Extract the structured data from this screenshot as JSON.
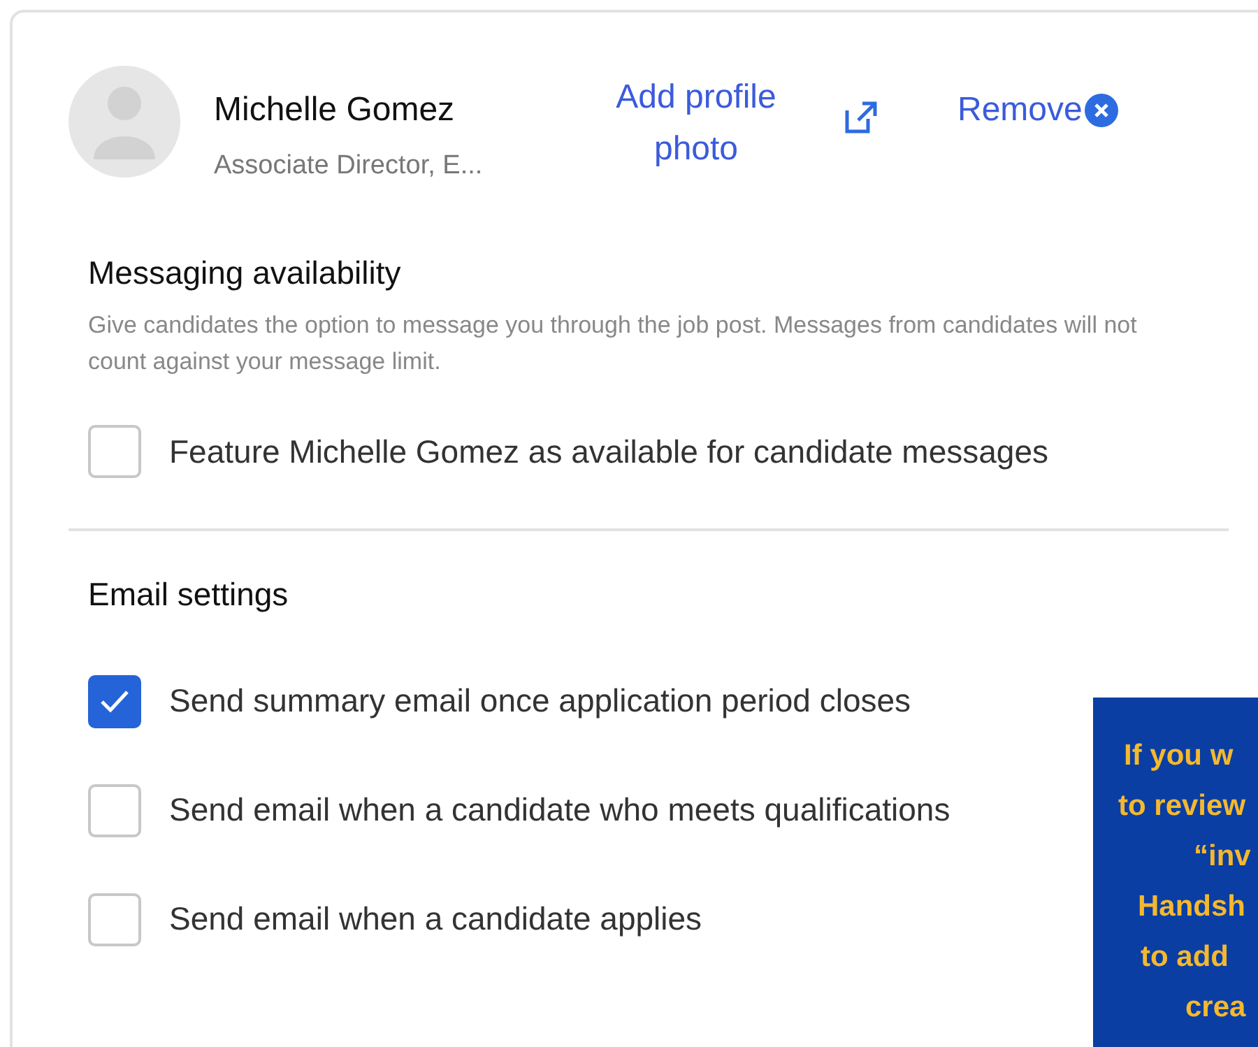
{
  "profile": {
    "name": "Michelle Gomez",
    "title": "Associate Director, E...",
    "add_photo": "Add profile photo",
    "remove": "Remove"
  },
  "messaging": {
    "heading": "Messaging availability",
    "description": "Give candidates the option to message you through the job post. Messages from candidates will not count against your message limit.",
    "options": [
      {
        "label": "Feature Michelle Gomez as available for candidate messages",
        "checked": false
      }
    ]
  },
  "email": {
    "heading": "Email settings",
    "options": [
      {
        "label": "Send summary email once application period closes",
        "checked": true
      },
      {
        "label": "Send email when a candidate who meets qualifications",
        "checked": false
      },
      {
        "label": "Send email when a candidate applies",
        "checked": false
      }
    ]
  },
  "overlay_note": {
    "lines": [
      "If you w",
      "to review",
      "“inv",
      "Handsh",
      "to add",
      "crea"
    ]
  }
}
